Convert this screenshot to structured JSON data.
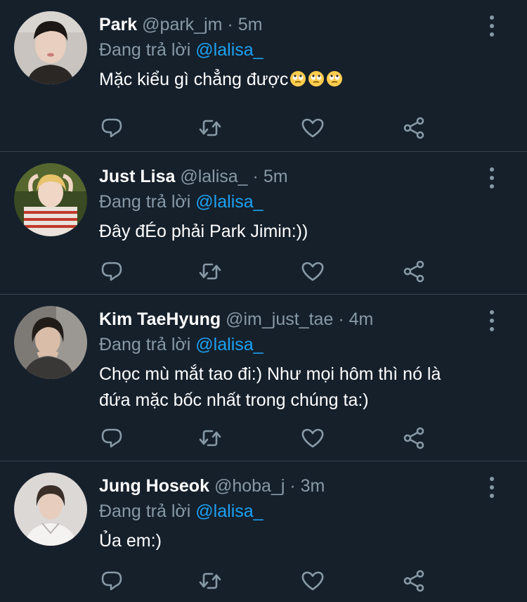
{
  "replying_prefix": "Đang trả lời",
  "colors": {
    "background": "#15202b",
    "muted": "#8899a6",
    "accent": "#1da1f2",
    "divider": "#38444d"
  },
  "icons": {
    "reply": "comment-icon",
    "retweet": "retweet-icon",
    "like": "heart-icon",
    "share": "share-icon",
    "more": "more-vertical-icon"
  },
  "tweets": [
    {
      "name": "Park",
      "handle": "@park_jm",
      "dot": "·",
      "time": "5m",
      "mention": "@lalisa_",
      "text": "Mặc kiểu gì chẳng được",
      "emojis": [
        "rolling-eyes-emoji",
        "rolling-eyes-emoji",
        "rolling-eyes-emoji"
      ]
    },
    {
      "name": "Just Lisa",
      "handle": "@lalisa_",
      "dot": "·",
      "time": "5m",
      "mention": "@lalisa_",
      "text": "Đây đÉo phải Park Jimin:))"
    },
    {
      "name": "Kim TaeHyung",
      "handle": "@im_just_tae",
      "dot": "·",
      "time": "4m",
      "mention": "@lalisa_",
      "text_line1": "Chọc mù mắt tao đi:) Như mọi hôm thì nó là",
      "text_line2": "đứa mặc bốc nhất trong chúng ta:)"
    },
    {
      "name": "Jung Hoseok",
      "handle": "@hoba_j",
      "dot": "·",
      "time": "3m",
      "mention": "@lalisa_",
      "text": "Ủa em:)"
    }
  ]
}
